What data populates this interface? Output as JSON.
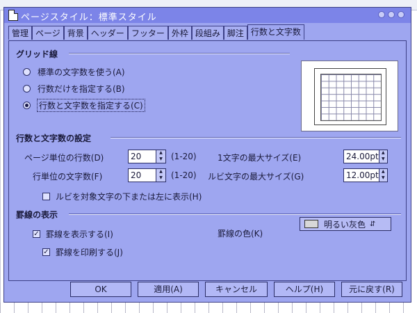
{
  "dialog": {
    "title": "ページスタイル：標準スタイル"
  },
  "tabs": [
    {
      "label": "管理"
    },
    {
      "label": "ページ"
    },
    {
      "label": "背景"
    },
    {
      "label": "ヘッダー"
    },
    {
      "label": "フッター"
    },
    {
      "label": "外枠"
    },
    {
      "label": "段組み"
    },
    {
      "label": "脚注"
    },
    {
      "label": "行数と文字数",
      "active": true
    }
  ],
  "grid_lines": {
    "title": "グリッド線",
    "options": [
      {
        "label": "標準の文字数を使う(A)",
        "selected": false
      },
      {
        "label": "行数だけを指定する(B)",
        "selected": false
      },
      {
        "label": "行数と文字数を指定する(C)",
        "selected": true
      }
    ]
  },
  "settings": {
    "title": "行数と文字数の設定",
    "lines_per_page_label": "ページ単位の行数(D)",
    "lines_per_page_value": "20",
    "lines_per_page_range": "(1-20)",
    "chars_per_line_label": "行単位の文字数(F)",
    "chars_per_line_value": "20",
    "chars_per_line_range": "(1-20)",
    "max_char_size_label": "1文字の最大サイズ(E)",
    "max_char_size_value": "24.00pt",
    "max_ruby_size_label": "ルビ文字の最大サイズ(G)",
    "max_ruby_size_value": "12.00pt",
    "ruby_below_label": "ルビを対象文字の下または左に表示(H)",
    "ruby_below_checked": false
  },
  "ruled_lines": {
    "title": "罫線の表示",
    "show_label": "罫線を表示する(I)",
    "show_checked": true,
    "print_label": "罫線を印刷する(J)",
    "print_checked": true,
    "color_label": "罫線の色(K)",
    "color_value": "明るい灰色",
    "color_swatch": "#d8d8d8"
  },
  "buttons": {
    "ok": "OK",
    "apply": "適用(A)",
    "cancel": "キャンセル",
    "help": "ヘルプ(H)",
    "reset": "元に戻す(R)"
  },
  "icons": {
    "spin_up": "▲",
    "spin_down": "▼",
    "check": "✓",
    "dropdown": "⇵"
  },
  "colors": {
    "dialog_bg": "#9ea6f0",
    "title_bg": "#7c84e8"
  }
}
